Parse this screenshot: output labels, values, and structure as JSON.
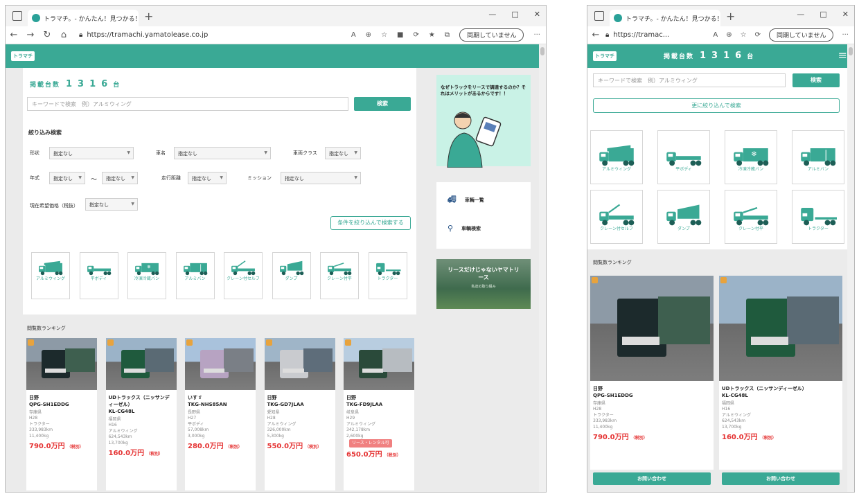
{
  "browser": {
    "tab_title": "トラマチ。- かんたん！見つかる！中...",
    "url": "https://tramachi.yamatolease.co.jp",
    "url_short": "https://tramac...",
    "sync_label": "同期していません",
    "win_min": "—",
    "win_max": "□",
    "win_close": "✕",
    "tab_close": "✕",
    "new_tab": "+"
  },
  "site": {
    "logo": "トラマチ",
    "count_label": "掲載台数",
    "count_value": "1316",
    "count_unit": "台",
    "hamburger": "≡"
  },
  "search": {
    "placeholder": "キーワードで検索　例）アルミウィング",
    "button": "検索",
    "refine_mobile": "更に絞り込んで検索"
  },
  "filter": {
    "title": "絞り込み検索",
    "labels": {
      "shape": "形状",
      "maker": "車名",
      "class": "車両クラス",
      "year": "年式",
      "mileage": "走行距離",
      "mission": "ミッション",
      "price": "現在希望価格（税抜）"
    },
    "any": "指定なし",
    "tilde": "〜",
    "submit": "条件を絞り込んで検索する"
  },
  "categories": [
    "アルミウィング",
    "平ボディ",
    "冷凍冷蔵バン",
    "アルミバン",
    "クレーン付セルフ",
    "ダンプ",
    "クレーン付平",
    "トラクター"
  ],
  "sidebar": {
    "banner_text": "なぜトラックをリースで調達するのか？それはメリットがあるからです！！",
    "link_list": "車輌一覧",
    "link_search": "車輌検索",
    "lease_banner_title": "リースだけじゃないヤマトリース",
    "lease_banner_sub": "私達の取り組み"
  },
  "ranking": {
    "title": "閲覧数ランキング",
    "inquiry": "お問い合わせ",
    "tax": "（税別）",
    "unit": "万円",
    "items": [
      {
        "maker": "日野",
        "model": "QPG-SH1EDDG",
        "specs": [
          "存庫県",
          "H28",
          "トラクター",
          "333,983km",
          "11,400kg"
        ],
        "price": "790.0",
        "badge": ""
      },
      {
        "maker": "UDトラックス（ニッサンディーゼル）",
        "model": "KL-CG48L",
        "specs": [
          "福岡県",
          "H16",
          "アルミウィング",
          "624,543km",
          "13,700kg"
        ],
        "price": "160.0",
        "badge": ""
      },
      {
        "maker": "いすゞ",
        "model": "TKG-NHS85AN",
        "specs": [
          "長野県",
          "H27",
          "平ボディ",
          "57,008km",
          "3,000kg"
        ],
        "price": "280.0",
        "badge": ""
      },
      {
        "maker": "日野",
        "model": "TKG-GD7JLAA",
        "specs": [
          "愛知県",
          "H28",
          "アルミウィング",
          "326,000km",
          "5,300kg"
        ],
        "price": "550.0",
        "badge": ""
      },
      {
        "maker": "日野",
        "model": "TKG-FD9JLAA",
        "specs": [
          "岐阜県",
          "H29",
          "アルミウィング",
          "342,178km",
          "2,600kg"
        ],
        "price": "650.0",
        "badge": "リース・レンタル可"
      }
    ]
  }
}
